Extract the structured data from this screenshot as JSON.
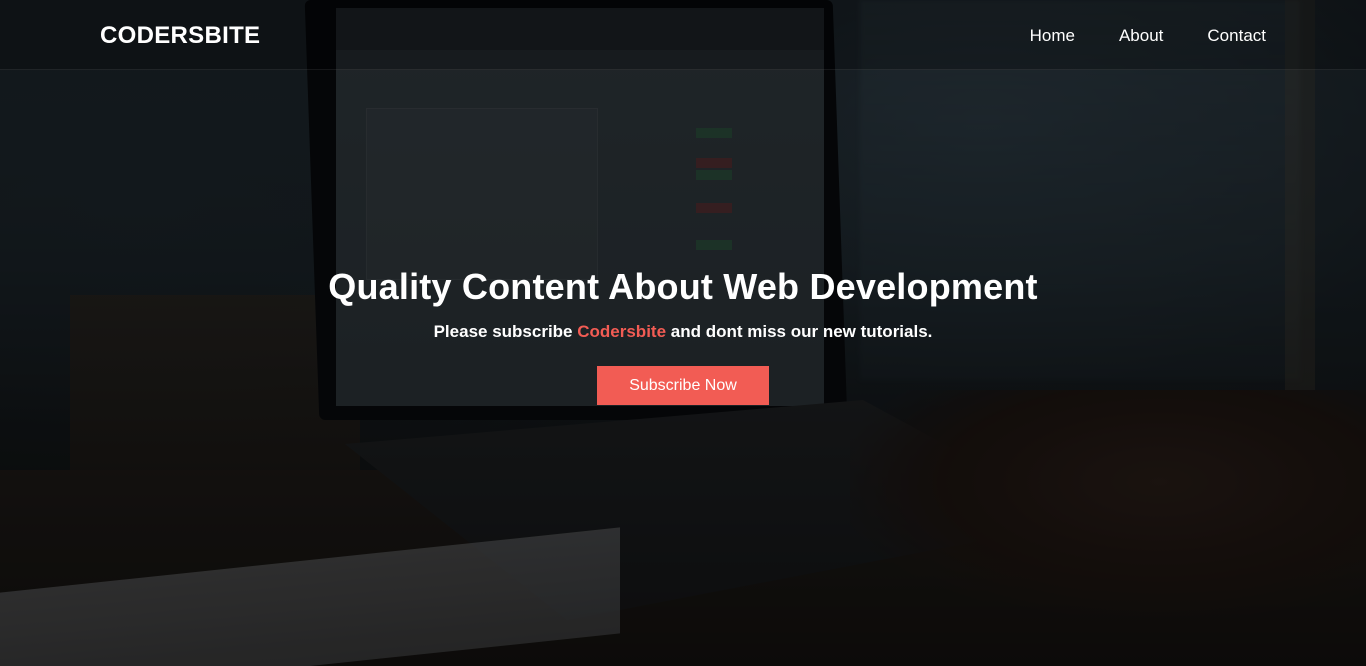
{
  "navbar": {
    "brand": "CODERSBITE",
    "links": [
      {
        "label": "Home"
      },
      {
        "label": "About"
      },
      {
        "label": "Contact"
      }
    ]
  },
  "hero": {
    "headline": "Quality Content About Web Development",
    "subline_prefix": "Please subscribe ",
    "subline_brand": "Codersbite",
    "subline_suffix": " and dont miss our new tutorials.",
    "cta_label": "Subscribe Now"
  },
  "colors": {
    "accent": "#f25c54",
    "text": "#ffffff",
    "overlay": "rgba(0,0,0,0.55)"
  }
}
